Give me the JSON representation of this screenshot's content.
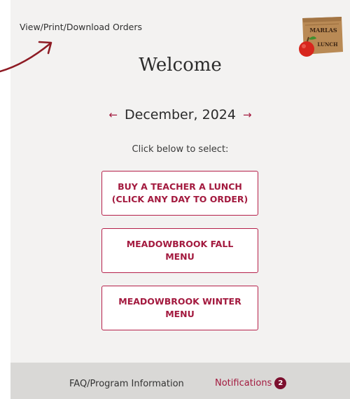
{
  "header": {
    "orders_link": "View/Print/Download Orders",
    "logo_text_top": "MARLAS",
    "logo_text_bottom": "LUNCH"
  },
  "main": {
    "welcome": "Welcome",
    "prev_arrow": "←",
    "month": "December, 2024",
    "next_arrow": "→",
    "hint": "Click below to select:",
    "buttons": [
      {
        "label": "BUY A TEACHER A LUNCH\n(CLICK ANY DAY TO ORDER)"
      },
      {
        "label": "MEADOWBROOK FALL\nMENU"
      },
      {
        "label": "MEADOWBROOK WINTER\nMENU"
      }
    ]
  },
  "footer": {
    "faq": "FAQ/Program Information",
    "notifications": "Notifications",
    "notification_count": "2"
  },
  "colors": {
    "accent": "#a31a3f",
    "panel_bg": "#f3f2f1",
    "footer_bg": "#d9d8d6",
    "badge_bg": "#7c0f2e"
  }
}
